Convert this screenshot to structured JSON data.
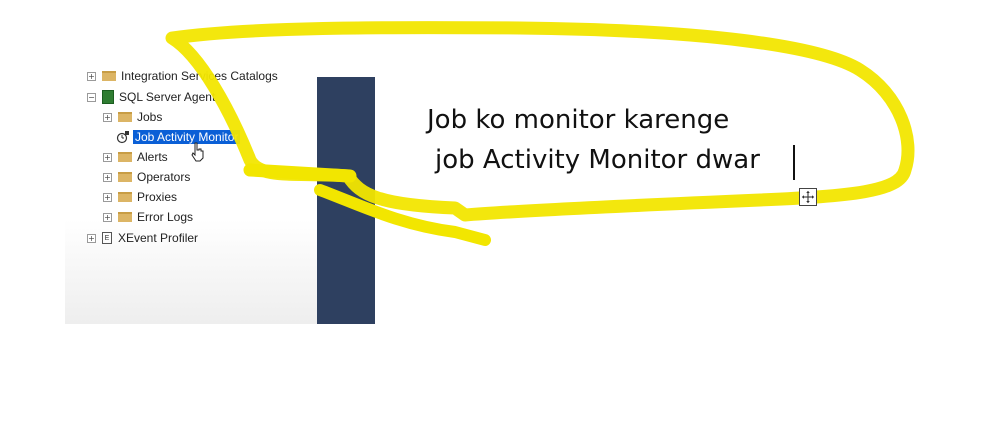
{
  "object_explorer": {
    "nodes": [
      {
        "label": "Integration Services Catalogs",
        "expander": "+",
        "icon": "folder-icon"
      },
      {
        "label": "SQL Server Agent",
        "expander": "−",
        "icon": "sql-agent-icon"
      },
      {
        "label": "Jobs",
        "expander": "+",
        "icon": "folder-icon"
      },
      {
        "label": "Job Activity Monitor",
        "expander": "",
        "icon": "job-activity-monitor-icon",
        "selected": true
      },
      {
        "label": "Alerts",
        "expander": "+",
        "icon": "folder-icon"
      },
      {
        "label": "Operators",
        "expander": "+",
        "icon": "folder-icon"
      },
      {
        "label": "Proxies",
        "expander": "+",
        "icon": "folder-icon"
      },
      {
        "label": "Error Logs",
        "expander": "+",
        "icon": "folder-icon"
      },
      {
        "label": "XEvent Profiler",
        "expander": "+",
        "icon": "xevent-profiler-icon"
      }
    ]
  },
  "annotation": {
    "line1": "Job ko monitor karenge",
    "line2": "job Activity Monitor dwar"
  },
  "colors": {
    "highlight": "#f2e600",
    "selection": "#0a5fd6",
    "panel_dark": "#2e4060"
  }
}
